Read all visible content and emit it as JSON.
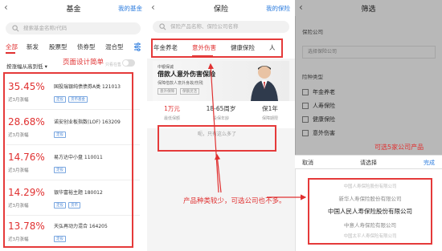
{
  "fund": {
    "back": "‹",
    "title": "基金",
    "right_link": "我的基金",
    "search_placeholder": "搜索基金名称/代码",
    "tabs": [
      "全部",
      "新发",
      "股票型",
      "债券型",
      "混合型"
    ],
    "sort_label": "按涨幅从高到低 ▾",
    "toggle_hint": "只看在售",
    "annotation": "页面设计简单",
    "items": [
      {
        "pct": "35.45%",
        "label": "近3月涨幅",
        "name": "国投瑞银纯债债券A类 121013",
        "tags": [
          "定投",
          "货币基金"
        ]
      },
      {
        "pct": "28.68%",
        "label": "近3月涨幅",
        "name": "诺安创业板指数(LOF) 163209",
        "tags": [
          "定投"
        ]
      },
      {
        "pct": "14.76%",
        "label": "近3月涨幅",
        "name": "易方达中小盘 110011",
        "tags": [
          "定投"
        ]
      },
      {
        "pct": "14.29%",
        "label": "近3月涨幅",
        "name": "银华富裕主题 180012",
        "tags": [
          "定投",
          "货币"
        ]
      },
      {
        "pct": "13.78%",
        "label": "近3月涨幅",
        "name": "天弘再动力混合 164205",
        "tags": [
          "定投"
        ]
      }
    ]
  },
  "insurance": {
    "back": "‹",
    "title": "保险",
    "right_link": "我的保险",
    "search_placeholder": "保险产品名称、保险公司名称",
    "tabs": [
      "年金养老",
      "意外伤害",
      "健康保险",
      "人"
    ],
    "banner": {
      "sub": "中银保诚",
      "title": "借款人意外伤害保险",
      "desc": "保障借款人意外身故/伤残",
      "tag1": "意外保障",
      "tag2": "保额灵活"
    },
    "stats": [
      {
        "value": "1万元",
        "label": "最低保额",
        "red": true
      },
      {
        "value": "18-65周岁",
        "label": "投保年龄",
        "red": false
      },
      {
        "value": "保1年",
        "label": "保障期限",
        "red": false
      }
    ],
    "empty_text": "呃，只有这么多了",
    "annotation": "产品种类较少，可选公司也不多。"
  },
  "filter": {
    "back": "‹",
    "title": "筛选",
    "company_label": "保险公司",
    "company_placeholder": "选择保险公司",
    "type_label": "险种类型",
    "types": [
      "年金养老",
      "人寿保险",
      "健康保险",
      "意外伤害"
    ],
    "annotation": "可选5家公司产品",
    "picker": {
      "cancel": "取消",
      "title": "请选择",
      "done": "完成",
      "companies": [
        "中国人寿保险股份有限公司",
        "新华人寿保险股份有限公司",
        "中国人民人寿保险股份有限公司",
        "中意人寿保险有限公司",
        "中国太平人寿保险有限公司"
      ]
    }
  },
  "colors": {
    "accent_red": "#e03030",
    "link_blue": "#2a7bde",
    "annotation_box": "#e53a3a"
  }
}
